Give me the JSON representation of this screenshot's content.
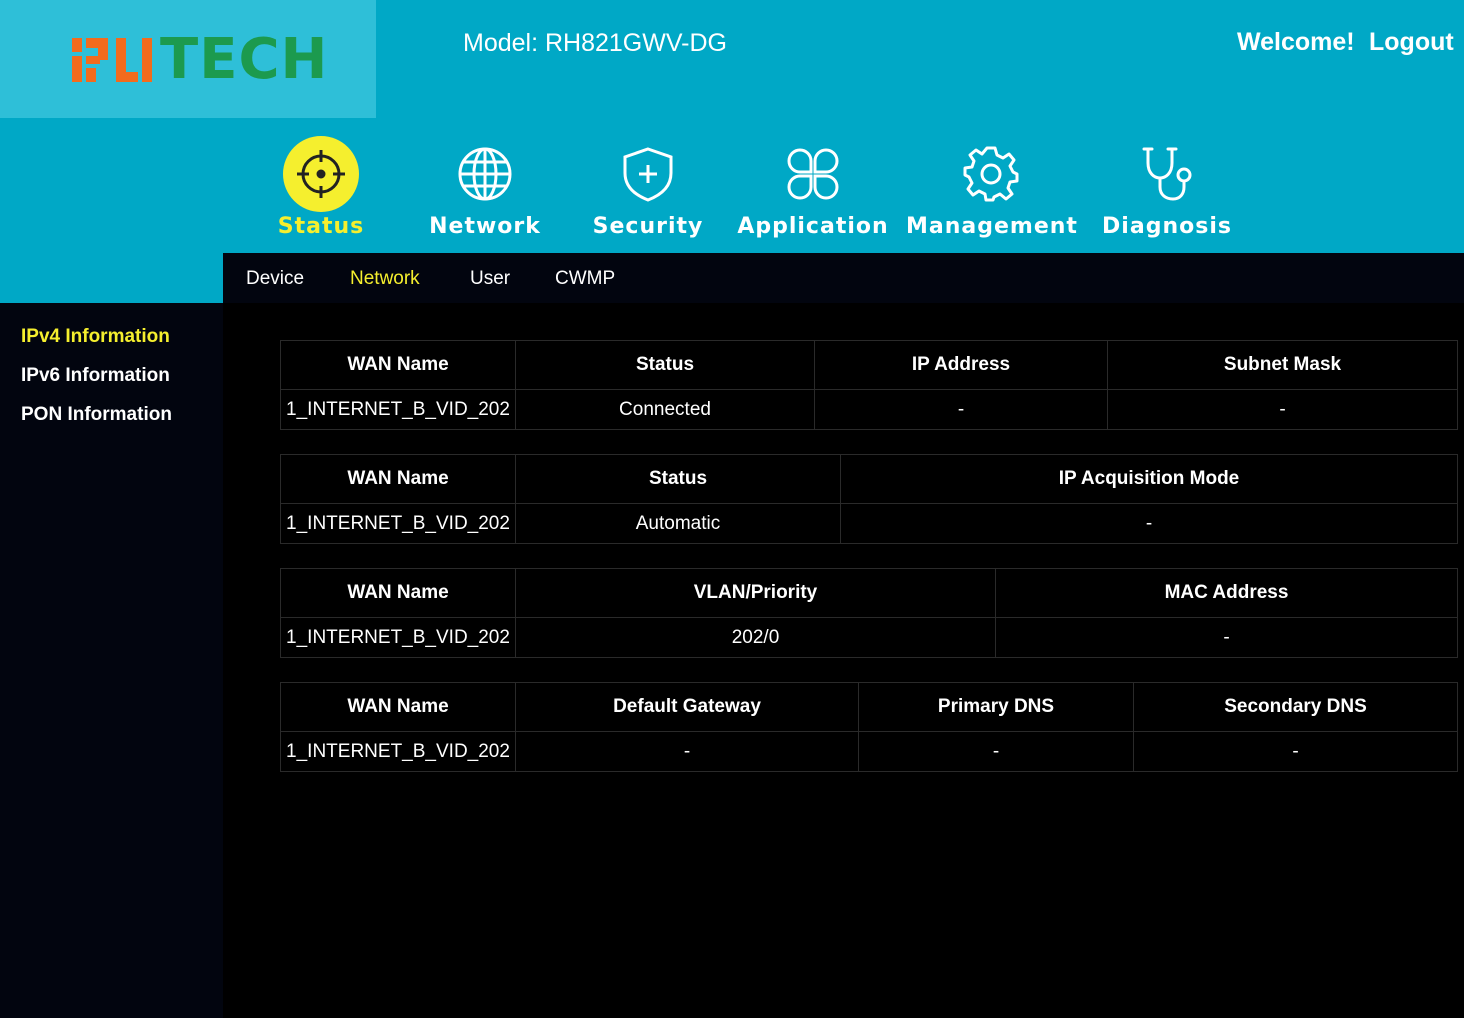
{
  "brand": {
    "logo_text": "TECH"
  },
  "header": {
    "model": "Model: RH821GWV-DG",
    "welcome": "Welcome!",
    "logout": "Logout"
  },
  "nav": [
    {
      "label": "Status",
      "icon": "crosshair-icon",
      "active": true
    },
    {
      "label": "Network",
      "icon": "globe-icon"
    },
    {
      "label": "Security",
      "icon": "shield-plus-icon"
    },
    {
      "label": "Application",
      "icon": "apps-grid-icon"
    },
    {
      "label": "Management",
      "icon": "gear-icon"
    },
    {
      "label": "Diagnosis",
      "icon": "stethoscope-icon"
    }
  ],
  "subnav": [
    {
      "label": "Device"
    },
    {
      "label": "Network",
      "active": true
    },
    {
      "label": "User"
    },
    {
      "label": "CWMP"
    }
  ],
  "sidebar": [
    {
      "label": "IPv4 Information",
      "active": true
    },
    {
      "label": "IPv6 Information"
    },
    {
      "label": "PON Information"
    }
  ],
  "tables": [
    {
      "headers": [
        "WAN Name",
        "Status",
        "IP Address",
        "Subnet Mask"
      ],
      "row": [
        "1_INTERNET_B_VID_202",
        "Connected",
        "-",
        "-"
      ]
    },
    {
      "headers": [
        "WAN Name",
        "Status",
        "IP Acquisition Mode"
      ],
      "row": [
        "1_INTERNET_B_VID_202",
        "Automatic",
        "-"
      ]
    },
    {
      "headers": [
        "WAN Name",
        "VLAN/Priority",
        "MAC Address"
      ],
      "row": [
        "1_INTERNET_B_VID_202",
        "202/0",
        "-"
      ]
    },
    {
      "headers": [
        "WAN Name",
        "Default Gateway",
        "Primary DNS",
        "Secondary DNS"
      ],
      "row": [
        "1_INTERNET_B_VID_202",
        "-",
        "-",
        "-"
      ]
    }
  ],
  "colors": {
    "header_bg": "#00a8c6",
    "logo_bg": "#2ebfd8",
    "accent_yellow": "#f5ef2e",
    "logo_orange": "#f26b1d",
    "logo_green": "#1c9a4e",
    "panel_dark": "#02050f"
  }
}
